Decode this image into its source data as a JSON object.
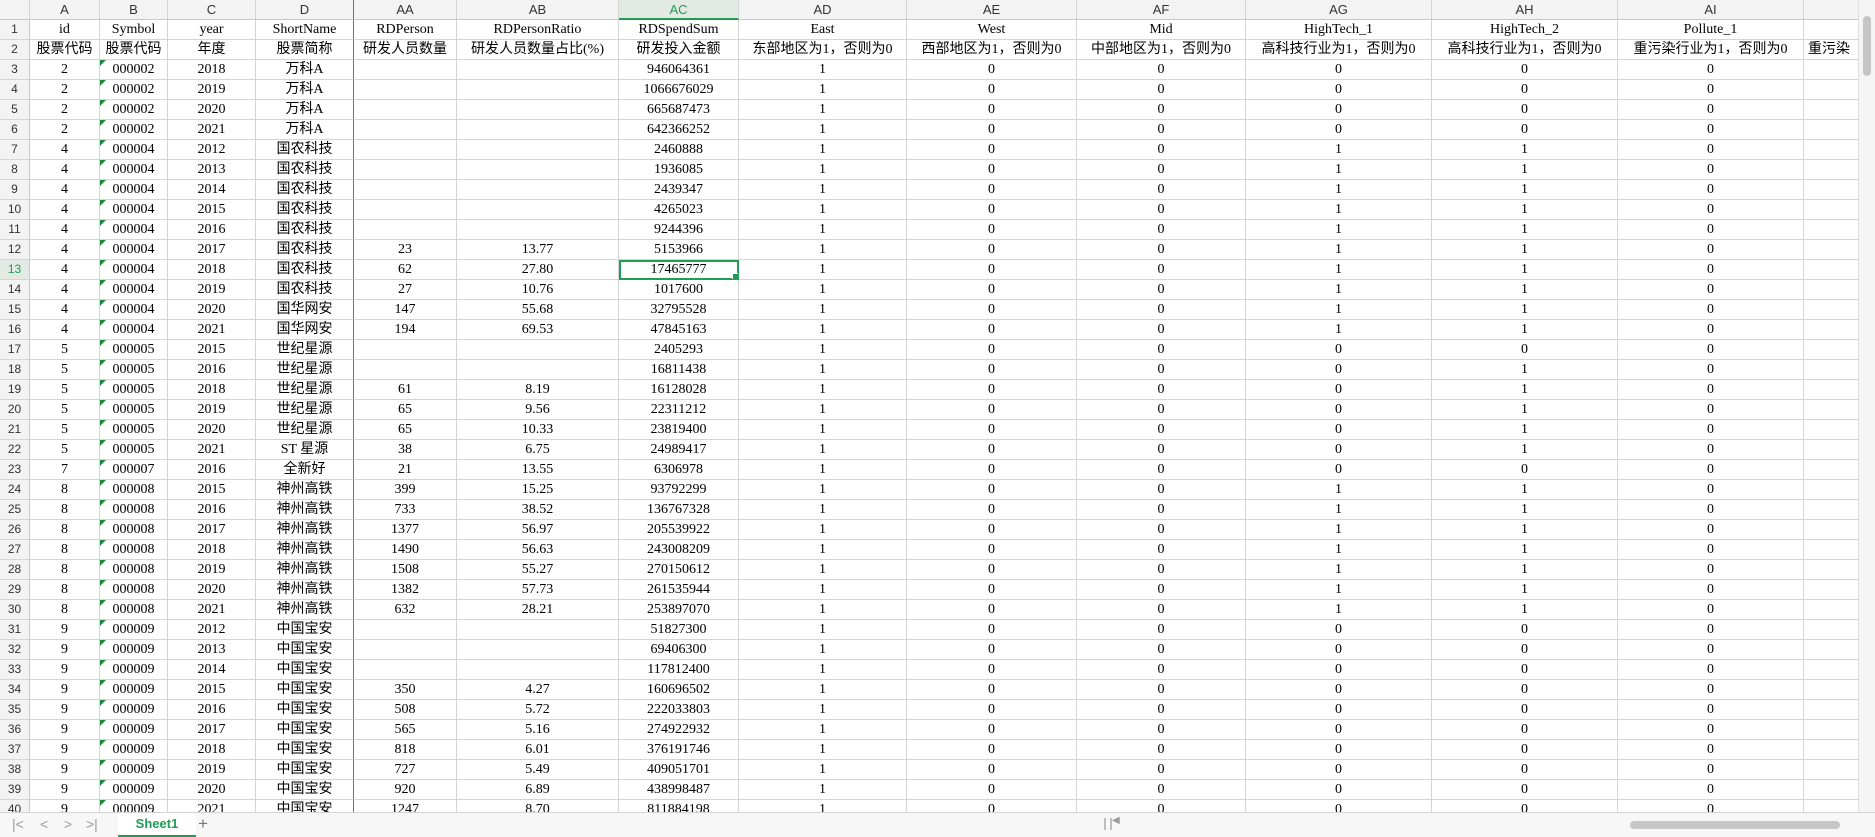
{
  "columns": [
    "A",
    "B",
    "C",
    "D",
    "AA",
    "AB",
    "AC",
    "AD",
    "AE",
    "AF",
    "AG",
    "AH",
    "AI",
    ""
  ],
  "selected_column": "AC",
  "selected_row": "13",
  "header_row1": [
    "id",
    "Symbol",
    "year",
    "ShortName",
    "RDPerson",
    "RDPersonRatio",
    "RDSpendSum",
    "East",
    "West",
    "Mid",
    "HighTech_1",
    "HighTech_2",
    "Pollute_1",
    ""
  ],
  "header_row2": [
    "股票代码",
    "股票代码",
    "年度",
    "股票简称",
    "研发人员数量",
    "研发人员数量占比(%)",
    "研发投入金额",
    "东部地区为1，否则为0",
    "西部地区为1，否则为0",
    "中部地区为1，否则为0",
    "高科技行业为1，否则为0",
    "高科技行业为1，否则为0",
    "重污染行业为1，否则为0",
    "重污染"
  ],
  "rows": [
    [
      "3",
      "2",
      "000002",
      "2018",
      "万科A",
      "",
      "",
      "946064361",
      "1",
      "0",
      "0",
      "0",
      "0",
      "0",
      ""
    ],
    [
      "4",
      "2",
      "000002",
      "2019",
      "万科A",
      "",
      "",
      "1066676029",
      "1",
      "0",
      "0",
      "0",
      "0",
      "0",
      ""
    ],
    [
      "5",
      "2",
      "000002",
      "2020",
      "万科A",
      "",
      "",
      "665687473",
      "1",
      "0",
      "0",
      "0",
      "0",
      "0",
      ""
    ],
    [
      "6",
      "2",
      "000002",
      "2021",
      "万科A",
      "",
      "",
      "642366252",
      "1",
      "0",
      "0",
      "0",
      "0",
      "0",
      ""
    ],
    [
      "7",
      "4",
      "000004",
      "2012",
      "国农科技",
      "",
      "",
      "2460888",
      "1",
      "0",
      "0",
      "1",
      "1",
      "0",
      ""
    ],
    [
      "8",
      "4",
      "000004",
      "2013",
      "国农科技",
      "",
      "",
      "1936085",
      "1",
      "0",
      "0",
      "1",
      "1",
      "0",
      ""
    ],
    [
      "9",
      "4",
      "000004",
      "2014",
      "国农科技",
      "",
      "",
      "2439347",
      "1",
      "0",
      "0",
      "1",
      "1",
      "0",
      ""
    ],
    [
      "10",
      "4",
      "000004",
      "2015",
      "国农科技",
      "",
      "",
      "4265023",
      "1",
      "0",
      "0",
      "1",
      "1",
      "0",
      ""
    ],
    [
      "11",
      "4",
      "000004",
      "2016",
      "国农科技",
      "",
      "",
      "9244396",
      "1",
      "0",
      "0",
      "1",
      "1",
      "0",
      ""
    ],
    [
      "12",
      "4",
      "000004",
      "2017",
      "国农科技",
      "23",
      "13.77",
      "5153966",
      "1",
      "0",
      "0",
      "1",
      "1",
      "0",
      ""
    ],
    [
      "13",
      "4",
      "000004",
      "2018",
      "国农科技",
      "62",
      "27.80",
      "17465777",
      "1",
      "0",
      "0",
      "1",
      "1",
      "0",
      ""
    ],
    [
      "14",
      "4",
      "000004",
      "2019",
      "国农科技",
      "27",
      "10.76",
      "1017600",
      "1",
      "0",
      "0",
      "1",
      "1",
      "0",
      ""
    ],
    [
      "15",
      "4",
      "000004",
      "2020",
      "国华网安",
      "147",
      "55.68",
      "32795528",
      "1",
      "0",
      "0",
      "1",
      "1",
      "0",
      ""
    ],
    [
      "16",
      "4",
      "000004",
      "2021",
      "国华网安",
      "194",
      "69.53",
      "47845163",
      "1",
      "0",
      "0",
      "1",
      "1",
      "0",
      ""
    ],
    [
      "17",
      "5",
      "000005",
      "2015",
      "世纪星源",
      "",
      "",
      "2405293",
      "1",
      "0",
      "0",
      "0",
      "0",
      "0",
      ""
    ],
    [
      "18",
      "5",
      "000005",
      "2016",
      "世纪星源",
      "",
      "",
      "16811438",
      "1",
      "0",
      "0",
      "0",
      "1",
      "0",
      ""
    ],
    [
      "19",
      "5",
      "000005",
      "2018",
      "世纪星源",
      "61",
      "8.19",
      "16128028",
      "1",
      "0",
      "0",
      "0",
      "1",
      "0",
      ""
    ],
    [
      "20",
      "5",
      "000005",
      "2019",
      "世纪星源",
      "65",
      "9.56",
      "22311212",
      "1",
      "0",
      "0",
      "0",
      "1",
      "0",
      ""
    ],
    [
      "21",
      "5",
      "000005",
      "2020",
      "世纪星源",
      "65",
      "10.33",
      "23819400",
      "1",
      "0",
      "0",
      "0",
      "1",
      "0",
      ""
    ],
    [
      "22",
      "5",
      "000005",
      "2021",
      "ST 星源",
      "38",
      "6.75",
      "24989417",
      "1",
      "0",
      "0",
      "0",
      "1",
      "0",
      ""
    ],
    [
      "23",
      "7",
      "000007",
      "2016",
      "全新好",
      "21",
      "13.55",
      "6306978",
      "1",
      "0",
      "0",
      "0",
      "0",
      "0",
      ""
    ],
    [
      "24",
      "8",
      "000008",
      "2015",
      "神州高铁",
      "399",
      "15.25",
      "93792299",
      "1",
      "0",
      "0",
      "1",
      "1",
      "0",
      ""
    ],
    [
      "25",
      "8",
      "000008",
      "2016",
      "神州高铁",
      "733",
      "38.52",
      "136767328",
      "1",
      "0",
      "0",
      "1",
      "1",
      "0",
      ""
    ],
    [
      "26",
      "8",
      "000008",
      "2017",
      "神州高铁",
      "1377",
      "56.97",
      "205539922",
      "1",
      "0",
      "0",
      "1",
      "1",
      "0",
      ""
    ],
    [
      "27",
      "8",
      "000008",
      "2018",
      "神州高铁",
      "1490",
      "56.63",
      "243008209",
      "1",
      "0",
      "0",
      "1",
      "1",
      "0",
      ""
    ],
    [
      "28",
      "8",
      "000008",
      "2019",
      "神州高铁",
      "1508",
      "55.27",
      "270150612",
      "1",
      "0",
      "0",
      "1",
      "1",
      "0",
      ""
    ],
    [
      "29",
      "8",
      "000008",
      "2020",
      "神州高铁",
      "1382",
      "57.73",
      "261535944",
      "1",
      "0",
      "0",
      "1",
      "1",
      "0",
      ""
    ],
    [
      "30",
      "8",
      "000008",
      "2021",
      "神州高铁",
      "632",
      "28.21",
      "253897070",
      "1",
      "0",
      "0",
      "1",
      "1",
      "0",
      ""
    ],
    [
      "31",
      "9",
      "000009",
      "2012",
      "中国宝安",
      "",
      "",
      "51827300",
      "1",
      "0",
      "0",
      "0",
      "0",
      "0",
      ""
    ],
    [
      "32",
      "9",
      "000009",
      "2013",
      "中国宝安",
      "",
      "",
      "69406300",
      "1",
      "0",
      "0",
      "0",
      "0",
      "0",
      ""
    ],
    [
      "33",
      "9",
      "000009",
      "2014",
      "中国宝安",
      "",
      "",
      "117812400",
      "1",
      "0",
      "0",
      "0",
      "0",
      "0",
      ""
    ],
    [
      "34",
      "9",
      "000009",
      "2015",
      "中国宝安",
      "350",
      "4.27",
      "160696502",
      "1",
      "0",
      "0",
      "0",
      "0",
      "0",
      ""
    ],
    [
      "35",
      "9",
      "000009",
      "2016",
      "中国宝安",
      "508",
      "5.72",
      "222033803",
      "1",
      "0",
      "0",
      "0",
      "0",
      "0",
      ""
    ],
    [
      "36",
      "9",
      "000009",
      "2017",
      "中国宝安",
      "565",
      "5.16",
      "274922932",
      "1",
      "0",
      "0",
      "0",
      "0",
      "0",
      ""
    ],
    [
      "37",
      "9",
      "000009",
      "2018",
      "中国宝安",
      "818",
      "6.01",
      "376191746",
      "1",
      "0",
      "0",
      "0",
      "0",
      "0",
      ""
    ],
    [
      "38",
      "9",
      "000009",
      "2019",
      "中国宝安",
      "727",
      "5.49",
      "409051701",
      "1",
      "0",
      "0",
      "0",
      "0",
      "0",
      ""
    ],
    [
      "39",
      "9",
      "000009",
      "2020",
      "中国宝安",
      "920",
      "6.89",
      "438998487",
      "1",
      "0",
      "0",
      "0",
      "0",
      "0",
      ""
    ],
    [
      "40",
      "9",
      "000009",
      "2021",
      "中国宝安",
      "1247",
      "8.70",
      "811884198",
      "1",
      "0",
      "0",
      "0",
      "0",
      "0",
      ""
    ]
  ],
  "sheet_tab": "Sheet1",
  "nav": {
    "first": "|<",
    "prev": "<",
    "next": ">",
    "last": ">|",
    "add": "+"
  },
  "accent_color": "#1f9d55"
}
